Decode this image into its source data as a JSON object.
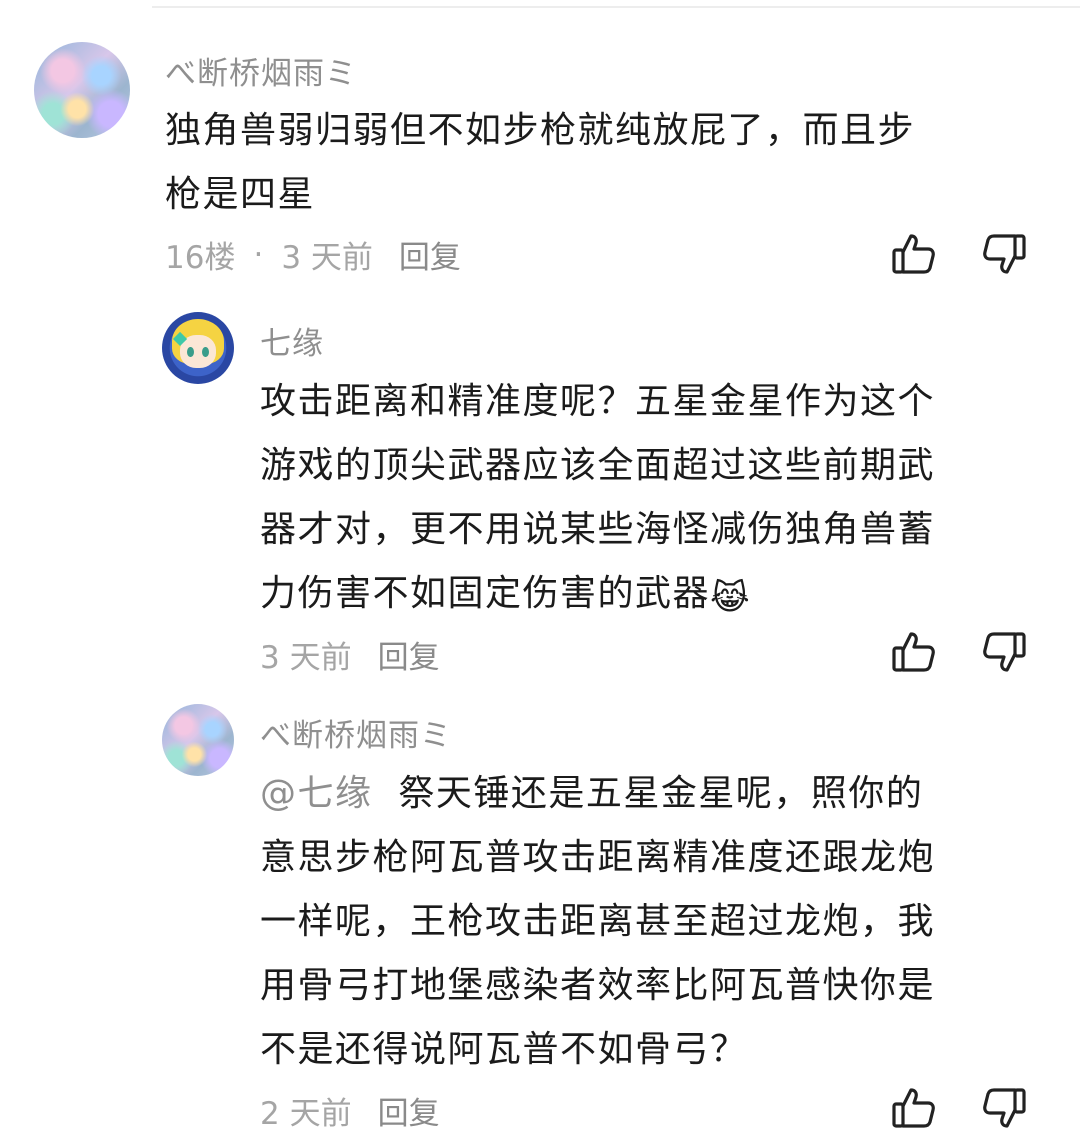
{
  "comments": [
    {
      "username": "べ断桥烟雨ミ",
      "text_lines": [
        "独角兽弱归弱但不如步枪就纯放屁了，而且步",
        "枪是四星"
      ],
      "floor": "16楼",
      "separator": "·",
      "time": "3 天前",
      "reply_label": "回复"
    },
    {
      "username": "七缘",
      "text_lines": [
        "攻击距离和精准度呢？五星金星作为这个",
        "游戏的顶尖武器应该全面超过这些前期武",
        "器才对，更不用说某些海怪减伤独角兽蓄",
        "力伤害不如固定伤害的武器"
      ],
      "emoji": "😹",
      "time": "3 天前",
      "reply_label": "回复"
    },
    {
      "username": "べ断桥烟雨ミ",
      "mention": "@七缘",
      "text_lines": [
        "祭天锤还是五星金星呢，照你的",
        "意思步枪阿瓦普攻击距离精准度还跟龙炮",
        "一样呢，王枪攻击距离甚至超过龙炮，我",
        "用骨弓打地堡感染者效率比阿瓦普快你是",
        "不是还得说阿瓦普不如骨弓？"
      ],
      "time": "2 天前",
      "reply_label": "回复"
    }
  ],
  "icons": {
    "like": "thumbs-up-icon",
    "dislike": "thumbs-down-icon"
  },
  "colors": {
    "text": "#1b1b1b",
    "username": "#8f8f8f",
    "meta": "#a5a5a5"
  }
}
